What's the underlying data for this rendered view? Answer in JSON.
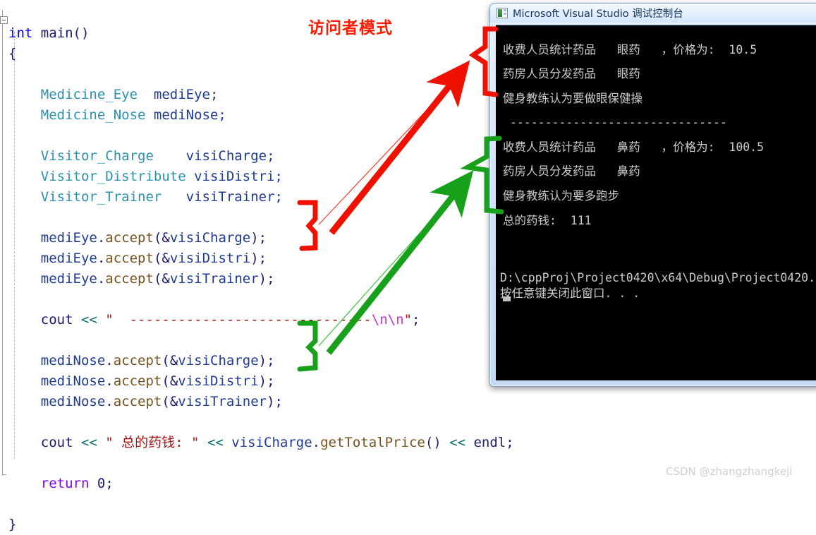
{
  "editor": {
    "language": "cpp",
    "fold_marker": "-",
    "lines": [
      [
        {
          "t": "int ",
          "c": "kw"
        },
        {
          "t": "main()",
          "c": "pln"
        }
      ],
      [
        {
          "t": "{",
          "c": "pln"
        }
      ],
      [
        {
          "t": "",
          "c": "pln"
        }
      ],
      [
        {
          "t": "    ",
          "c": "pln"
        },
        {
          "t": "Medicine_Eye",
          "c": "typ"
        },
        {
          "t": "  mediEye;",
          "c": "idf"
        }
      ],
      [
        {
          "t": "    ",
          "c": "pln"
        },
        {
          "t": "Medicine_Nose",
          "c": "typ"
        },
        {
          "t": " mediNose;",
          "c": "idf"
        }
      ],
      [
        {
          "t": "",
          "c": "pln"
        }
      ],
      [
        {
          "t": "    ",
          "c": "pln"
        },
        {
          "t": "Visitor_Charge",
          "c": "typ"
        },
        {
          "t": "    visiCharge;",
          "c": "idf"
        }
      ],
      [
        {
          "t": "    ",
          "c": "pln"
        },
        {
          "t": "Visitor_Distribute",
          "c": "typ"
        },
        {
          "t": " visiDistri;",
          "c": "idf"
        }
      ],
      [
        {
          "t": "    ",
          "c": "pln"
        },
        {
          "t": "Visitor_Trainer",
          "c": "typ"
        },
        {
          "t": "   visiTrainer;",
          "c": "idf"
        }
      ],
      [
        {
          "t": "",
          "c": "pln"
        }
      ],
      [
        {
          "t": "    ",
          "c": "pln"
        },
        {
          "t": "mediEye",
          "c": "idf"
        },
        {
          "t": ".",
          "c": "pln"
        },
        {
          "t": "accept",
          "c": "fn"
        },
        {
          "t": "(&",
          "c": "pln"
        },
        {
          "t": "visiCharge",
          "c": "idf"
        },
        {
          "t": ");",
          "c": "pln"
        }
      ],
      [
        {
          "t": "    ",
          "c": "pln"
        },
        {
          "t": "mediEye",
          "c": "idf"
        },
        {
          "t": ".",
          "c": "pln"
        },
        {
          "t": "accept",
          "c": "fn"
        },
        {
          "t": "(&",
          "c": "pln"
        },
        {
          "t": "visiDistri",
          "c": "idf"
        },
        {
          "t": ");",
          "c": "pln"
        }
      ],
      [
        {
          "t": "    ",
          "c": "pln"
        },
        {
          "t": "mediEye",
          "c": "idf"
        },
        {
          "t": ".",
          "c": "pln"
        },
        {
          "t": "accept",
          "c": "fn"
        },
        {
          "t": "(&",
          "c": "pln"
        },
        {
          "t": "visiTrainer",
          "c": "idf"
        },
        {
          "t": ");",
          "c": "pln"
        }
      ],
      [
        {
          "t": "",
          "c": "pln"
        }
      ],
      [
        {
          "t": "    ",
          "c": "pln"
        },
        {
          "t": "cout ",
          "c": "pln"
        },
        {
          "t": "<< ",
          "c": "op"
        },
        {
          "t": "\"  ------------------------------",
          "c": "str"
        },
        {
          "t": "\\n\\n",
          "c": "esc"
        },
        {
          "t": "\"",
          "c": "str"
        },
        {
          "t": ";",
          "c": "pln"
        }
      ],
      [
        {
          "t": "",
          "c": "pln"
        }
      ],
      [
        {
          "t": "    ",
          "c": "pln"
        },
        {
          "t": "mediNose",
          "c": "idf"
        },
        {
          "t": ".",
          "c": "pln"
        },
        {
          "t": "accept",
          "c": "fn"
        },
        {
          "t": "(&",
          "c": "pln"
        },
        {
          "t": "visiCharge",
          "c": "idf"
        },
        {
          "t": ");",
          "c": "pln"
        }
      ],
      [
        {
          "t": "    ",
          "c": "pln"
        },
        {
          "t": "mediNose",
          "c": "idf"
        },
        {
          "t": ".",
          "c": "pln"
        },
        {
          "t": "accept",
          "c": "fn"
        },
        {
          "t": "(&",
          "c": "pln"
        },
        {
          "t": "visiDistri",
          "c": "idf"
        },
        {
          "t": ");",
          "c": "pln"
        }
      ],
      [
        {
          "t": "    ",
          "c": "pln"
        },
        {
          "t": "mediNose",
          "c": "idf"
        },
        {
          "t": ".",
          "c": "pln"
        },
        {
          "t": "accept",
          "c": "fn"
        },
        {
          "t": "(&",
          "c": "pln"
        },
        {
          "t": "visiTrainer",
          "c": "idf"
        },
        {
          "t": ");",
          "c": "pln"
        }
      ],
      [
        {
          "t": "",
          "c": "pln"
        }
      ],
      [
        {
          "t": "    ",
          "c": "pln"
        },
        {
          "t": "cout ",
          "c": "pln"
        },
        {
          "t": "<< ",
          "c": "op"
        },
        {
          "t": "\" 总的药钱: \"",
          "c": "str"
        },
        {
          "t": " << ",
          "c": "op"
        },
        {
          "t": "visiCharge",
          "c": "idf"
        },
        {
          "t": ".",
          "c": "pln"
        },
        {
          "t": "getTotalPrice",
          "c": "fn"
        },
        {
          "t": "() ",
          "c": "pln"
        },
        {
          "t": "<< ",
          "c": "op"
        },
        {
          "t": "endl",
          "c": "pln"
        },
        {
          "t": ";",
          "c": "pln"
        }
      ],
      [
        {
          "t": "",
          "c": "pln"
        }
      ],
      [
        {
          "t": "    ",
          "c": "pln"
        },
        {
          "t": "return",
          "c": "pur"
        },
        {
          "t": " ",
          "c": "pln"
        },
        {
          "t": "0",
          "c": "pln"
        },
        {
          "t": ";",
          "c": "pln"
        }
      ],
      [
        {
          "t": "",
          "c": "pln"
        }
      ],
      [
        {
          "t": "}",
          "c": "pln"
        }
      ]
    ]
  },
  "annotation": {
    "title": "访问者模式",
    "title_color": "#ff1a00",
    "red_color": "#ee1100",
    "green_color": "#17a01a",
    "red_arrow_label": "red-arrow-eye-group",
    "green_arrow_label": "green-arrow-nose-group"
  },
  "console": {
    "title": "Microsoft Visual Studio 调试控制台",
    "icon": "console-app-icon",
    "lines": [
      "收费人员统计药品   眼药   ，价格为:  10.5",
      "药房人员分发药品   眼药",
      "健身教练认为要做眼保健操",
      " -------------------------------",
      "收费人员统计药品   鼻药   ，价格为:  100.5",
      "药房人员分发药品   鼻药",
      "健身教练认为要多跑步",
      "总的药钱:  111"
    ],
    "tail_lines": [
      "D:\\cppProj\\Project0420\\x64\\Debug\\Project0420.",
      "按任意键关闭此窗口. . ."
    ],
    "caret": "block-cursor"
  },
  "watermark": {
    "text": "CSDN @zhangzhangkeji"
  }
}
